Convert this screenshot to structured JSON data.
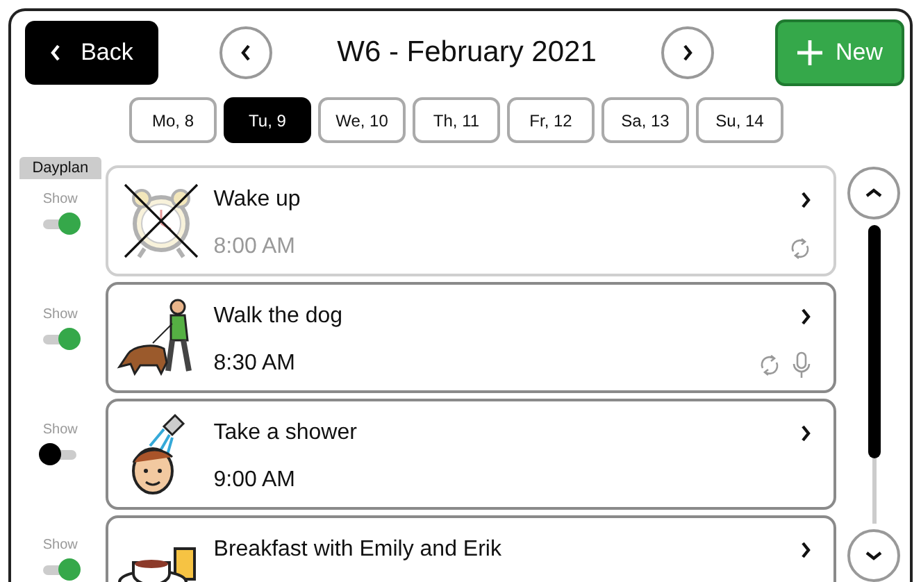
{
  "header": {
    "back_label": "Back",
    "title": "W6 - February 2021",
    "new_label": "New"
  },
  "days": [
    {
      "label": "Mo, 8",
      "selected": false
    },
    {
      "label": "Tu, 9",
      "selected": true
    },
    {
      "label": "We, 10",
      "selected": false
    },
    {
      "label": "Th, 11",
      "selected": false
    },
    {
      "label": "Fr, 12",
      "selected": false
    },
    {
      "label": "Sa, 13",
      "selected": false
    },
    {
      "label": "Su, 14",
      "selected": false
    }
  ],
  "dayplan_label": "Dayplan",
  "activities": [
    {
      "kind": "alarm",
      "title": "Wake up",
      "time": "8:00 AM",
      "show_label": "Show",
      "shown": true,
      "crossed_out": true,
      "repeats": true,
      "has_audio": false
    },
    {
      "kind": "dog",
      "title": "Walk the dog",
      "time": "8:30 AM",
      "show_label": "Show",
      "shown": true,
      "crossed_out": false,
      "repeats": true,
      "has_audio": true
    },
    {
      "kind": "shower",
      "title": "Take a shower",
      "time": "9:00 AM",
      "show_label": "Show",
      "shown": false,
      "crossed_out": false,
      "repeats": false,
      "has_audio": false
    },
    {
      "kind": "breakfast",
      "title": "Breakfast with Emily and Erik",
      "show_label": "Show",
      "shown": true,
      "crossed_out": false,
      "repeats": false,
      "has_audio": false
    }
  ]
}
